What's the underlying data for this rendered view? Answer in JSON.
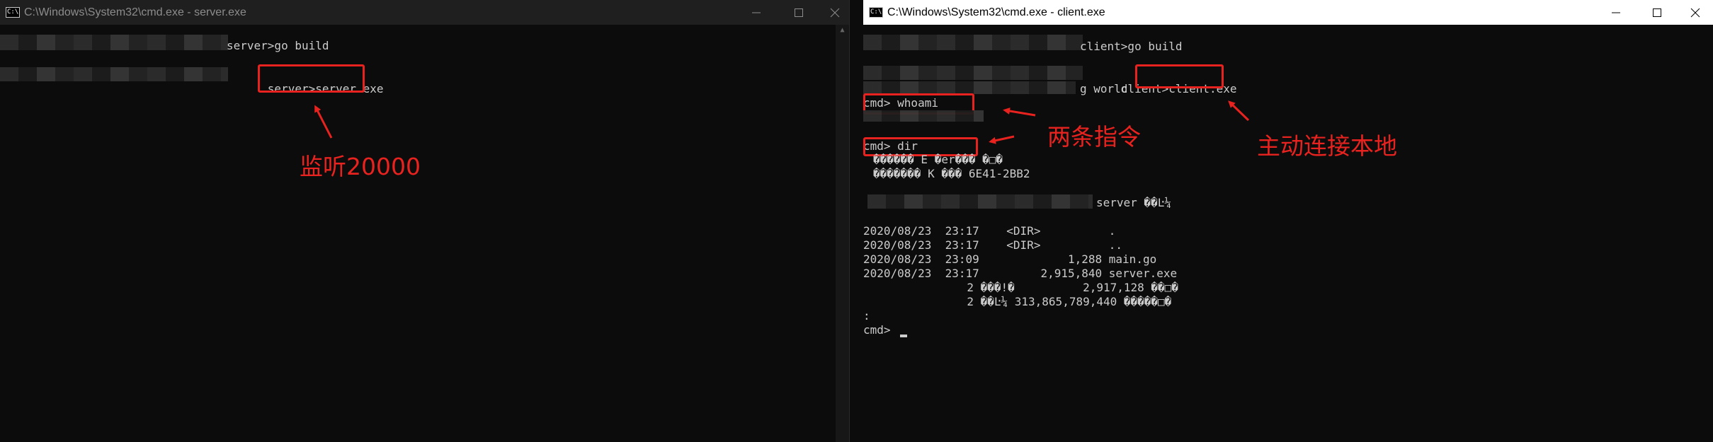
{
  "left_window": {
    "title": "C:\\Windows\\System32\\cmd.exe - server.exe",
    "icon_label": "C:\\",
    "lines": {
      "l1": "server>go build",
      "l2": "server>",
      "l2_cmd": "server.exe"
    },
    "annotation": "监听20000"
  },
  "right_window": {
    "title": "C:\\Windows\\System32\\cmd.exe - client.exe",
    "icon_label": "C:\\",
    "lines": {
      "go_build": "client>go build",
      "run_prefix": "client>",
      "run_cmd": "client.exe",
      "hello_world": "g world",
      "whoami": "cmd> whoami",
      "dir": "cmd> dir",
      "garbled1": "������ E �er��� �□�",
      "garbled2": "������� K ��� 6E41-2BB2",
      "dir_of": "server ��Ŀ¼",
      "row1": "2020/08/23  23:17    <DIR>          .",
      "row2": "2020/08/23  23:17    <DIR>          ..",
      "row3": "2020/08/23  23:09             1,288 main.go",
      "row4": "2020/08/23  23:17         2,915,840 server.exe",
      "summary1": "          2 ���!�          2,917,128 ��□�",
      "summary2": "          2 ��Ŀ¼ 313,865,789,440 �����□�",
      "colon": ":",
      "prompt": "cmd> "
    },
    "annotations": {
      "commands": "两条指令",
      "connect": "主动连接本地"
    }
  },
  "colors": {
    "annotation_red": "#e8231f",
    "terminal_bg": "#0c0c0c",
    "terminal_text": "#cccccc"
  },
  "icons": [
    "cmd-icon",
    "minimize-icon",
    "maximize-icon",
    "close-icon"
  ]
}
